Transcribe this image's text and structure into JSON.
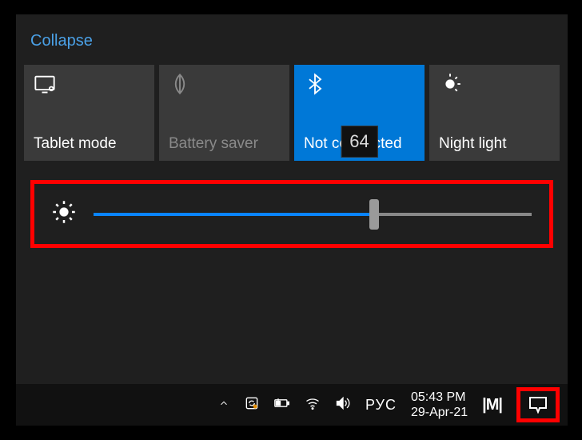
{
  "action_center": {
    "collapse_label": "Collapse",
    "tiles": [
      {
        "label": "Tablet mode",
        "state": "inactive",
        "icon": "tablet"
      },
      {
        "label": "Battery saver",
        "state": "disabled",
        "icon": "leaf"
      },
      {
        "label": "Not connected",
        "state": "active",
        "icon": "bluetooth"
      },
      {
        "label": "Night light",
        "state": "inactive",
        "icon": "sun-partial"
      }
    ],
    "brightness": {
      "value": 64,
      "min": 0,
      "max": 100,
      "tooltip": "64"
    }
  },
  "taskbar": {
    "ime_language": "РУС",
    "clock": {
      "time": "05:43 PM",
      "date": "29-Apr-21"
    },
    "brand_text": "|M|"
  },
  "colors": {
    "accent": "#0078d7",
    "highlight_border": "#ff0000"
  }
}
